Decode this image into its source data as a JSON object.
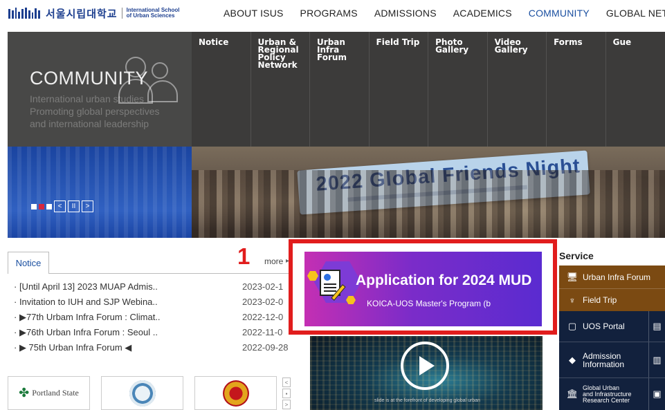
{
  "header": {
    "logo_korean": "서울시립대학교",
    "logo_english_line1": "International School",
    "logo_english_line2": "of Urban Sciences",
    "nav": [
      {
        "label": "ABOUT ISUS"
      },
      {
        "label": "PROGRAMS"
      },
      {
        "label": "ADMISSIONS"
      },
      {
        "label": "ACADEMICS"
      },
      {
        "label": "COMMUNITY",
        "active": true
      },
      {
        "label": "GLOBAL NETW"
      }
    ]
  },
  "hero": {
    "section_title": "COMMUNITY",
    "description": "International urban studies Promoting global perspectives and international leadership",
    "submenu": [
      "Notice",
      "Urban &\nRegional\nPolicy\nNetwork",
      "Urban Infra\nForum",
      "Field Trip",
      "Photo\nGallery",
      "Video\nGallery",
      "Forms",
      "Gue"
    ],
    "banner_text": "2022 Global Friends Night",
    "slider_prev": "<",
    "slider_pause": "II",
    "slider_next": ">"
  },
  "notice": {
    "tab_label": "Notice",
    "more_label": "more",
    "items": [
      {
        "title": "· [Until April 13] 2023 MUAP Admis..",
        "date": "2023-02-1"
      },
      {
        "title": "· Invitation to IUH and SJP Webina..",
        "date": "2023-02-0"
      },
      {
        "title": "· ▶77th Urbam Infra Forum : Climat..",
        "date": "2022-12-0"
      },
      {
        "title": "· ▶76th Urban Infra Forum : Seoul ..",
        "date": "2022-11-0"
      },
      {
        "title": "· ▶ 75th Urban Infra Forum ◀",
        "date": "2022-09-28"
      }
    ]
  },
  "annotation": {
    "number": "1"
  },
  "application_banner": {
    "title": "Application for 2024 MUD",
    "subtitle": "KOICA-UOS Master's Program (b"
  },
  "video": {
    "caption": "slide is at the forefront of developing global urban"
  },
  "partners": {
    "portland_name": "Portland State",
    "arrows": [
      "<",
      "▪",
      ">"
    ]
  },
  "service": {
    "title": "Service",
    "items": [
      {
        "label": "Urban Infra Forum",
        "icon": "monitor-icon"
      },
      {
        "label": "Field Trip",
        "icon": "plant-icon"
      },
      {
        "label": "UOS Portal",
        "icon": "portal-icon"
      },
      {
        "label": "Admission\nInformation",
        "icon": "diamond-icon"
      },
      {
        "label": "Global Urban\nand Infrastructure\nResearch Center",
        "icon": "building-icon"
      }
    ]
  },
  "colors": {
    "brand_blue": "#1d3f8f",
    "highlight_red": "#e11d1d",
    "service_brown": "#7b4a12",
    "service_navy": "#12213d"
  }
}
